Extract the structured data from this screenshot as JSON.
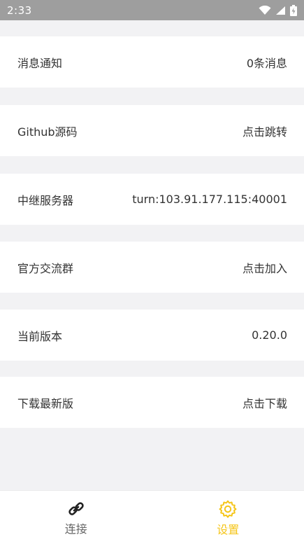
{
  "status_bar": {
    "time": "2:33",
    "icons": [
      "wifi-icon",
      "signal-icon",
      "battery-icon"
    ]
  },
  "settings": {
    "items": [
      {
        "label": "消息通知",
        "value": "0条消息"
      },
      {
        "label": "Github源码",
        "value": "点击跳转"
      },
      {
        "label": "中继服务器",
        "value": "turn:103.91.177.115:40001"
      },
      {
        "label": "官方交流群",
        "value": "点击加入"
      },
      {
        "label": "当前版本",
        "value": "0.20.0"
      },
      {
        "label": "下载最新版",
        "value": "点击下载"
      }
    ]
  },
  "tab_bar": {
    "tabs": [
      {
        "label": "连接",
        "icon": "link-icon",
        "active": false
      },
      {
        "label": "设置",
        "icon": "gear-icon",
        "active": true
      }
    ],
    "active_color": "#f5c518",
    "inactive_color": "#666666"
  }
}
